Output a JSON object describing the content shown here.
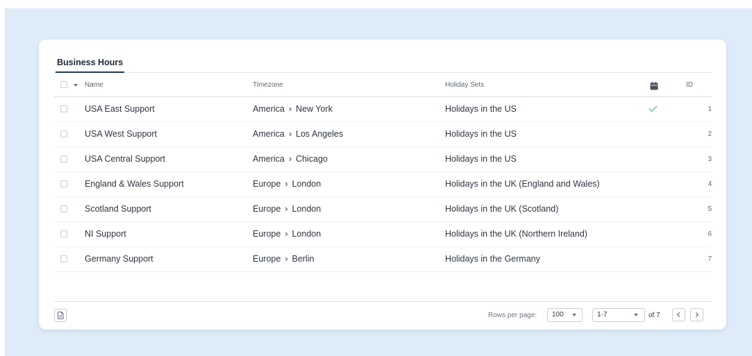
{
  "tabs": [
    {
      "label": "Business Hours",
      "active": true
    }
  ],
  "columns": {
    "name": "Name",
    "timezone": "Timezone",
    "holiday_sets": "Holiday Sets",
    "calendar_icon": "calendar-icon",
    "id": "ID"
  },
  "rows": [
    {
      "name": "USA East Support",
      "tz_region": "America",
      "tz_city": "New York",
      "holiday": "Holidays in the US",
      "default": true,
      "id": "1"
    },
    {
      "name": "USA West Support",
      "tz_region": "America",
      "tz_city": "Los Angeles",
      "holiday": "Holidays in the US",
      "default": false,
      "id": "2"
    },
    {
      "name": "USA Central Support",
      "tz_region": "America",
      "tz_city": "Chicago",
      "holiday": "Holidays in the US",
      "default": false,
      "id": "3"
    },
    {
      "name": "England & Wales Support",
      "tz_region": "Europe",
      "tz_city": "London",
      "holiday": "Holidays in the UK (England and Wales)",
      "default": false,
      "id": "4"
    },
    {
      "name": "Scotland Support",
      "tz_region": "Europe",
      "tz_city": "London",
      "holiday": "Holidays in the UK (Scotland)",
      "default": false,
      "id": "5"
    },
    {
      "name": "NI Support",
      "tz_region": "Europe",
      "tz_city": "London",
      "holiday": "Holidays in the UK (Northern Ireland)",
      "default": false,
      "id": "6"
    },
    {
      "name": "Germany Support",
      "tz_region": "Europe",
      "tz_city": "Berlin",
      "holiday": "Holidays in the Germany",
      "default": false,
      "id": "7"
    }
  ],
  "footer": {
    "rows_per_page_label": "Rows per page:",
    "rows_per_page_value": "100",
    "range_value": "1-7",
    "of_label": "of 7"
  },
  "colors": {
    "background": "#deebf9",
    "check_green": "#3eaa5e",
    "tab_underline": "#1f3a5a"
  }
}
